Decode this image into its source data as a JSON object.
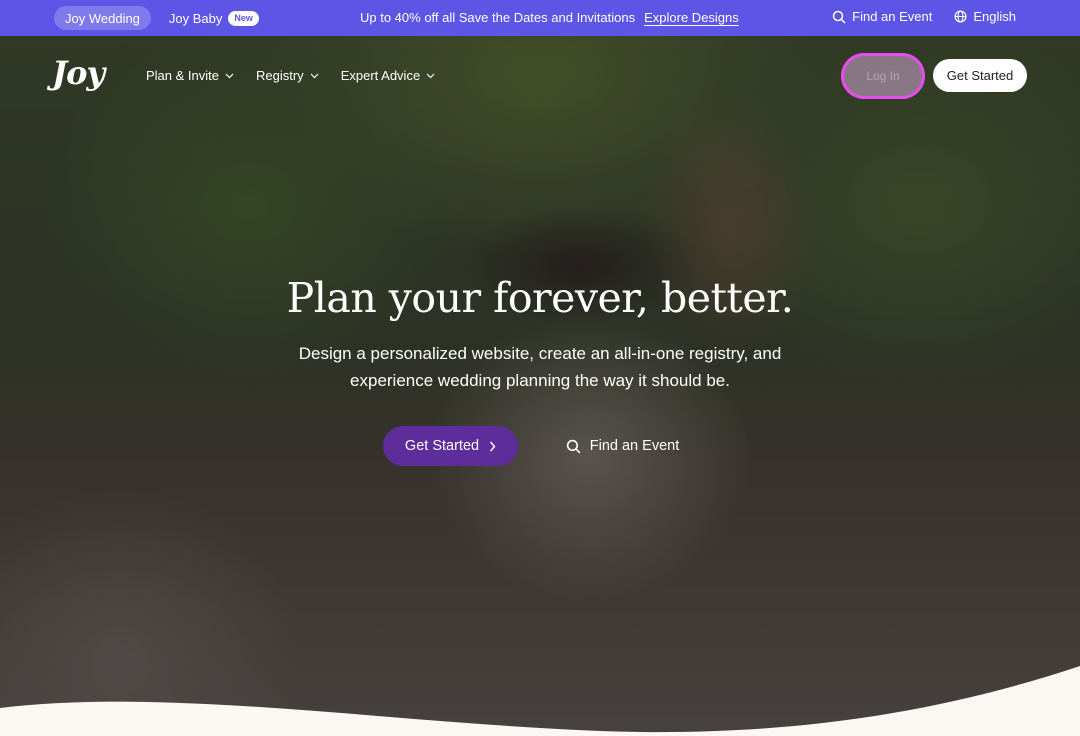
{
  "topbar": {
    "tabs": [
      {
        "label": "Joy Wedding",
        "active": true
      },
      {
        "label": "Joy Baby",
        "badge": "New"
      }
    ],
    "promo_text": "Up to 40% off all Save the Dates and Invitations",
    "promo_link": "Explore Designs",
    "find_event": "Find an Event",
    "language": "English",
    "bg_color": "#5c55e6"
  },
  "nav": {
    "logo": "Joy",
    "items": [
      {
        "label": "Plan & Invite"
      },
      {
        "label": "Registry"
      },
      {
        "label": "Expert Advice"
      }
    ],
    "login": "Log In",
    "get_started": "Get Started"
  },
  "hero": {
    "headline": "Plan your forever, better.",
    "subheadline": "Design a personalized website, create an all-in-one registry, and experience wedding planning the way it should be.",
    "primary_cta": "Get Started",
    "secondary_cta": "Find an Event",
    "primary_color": "#5c2d9b"
  },
  "icons": {
    "search": "search-icon",
    "globe": "globe-icon",
    "chevron": "chevron-down-icon",
    "chevron_right": "chevron-right-icon"
  }
}
